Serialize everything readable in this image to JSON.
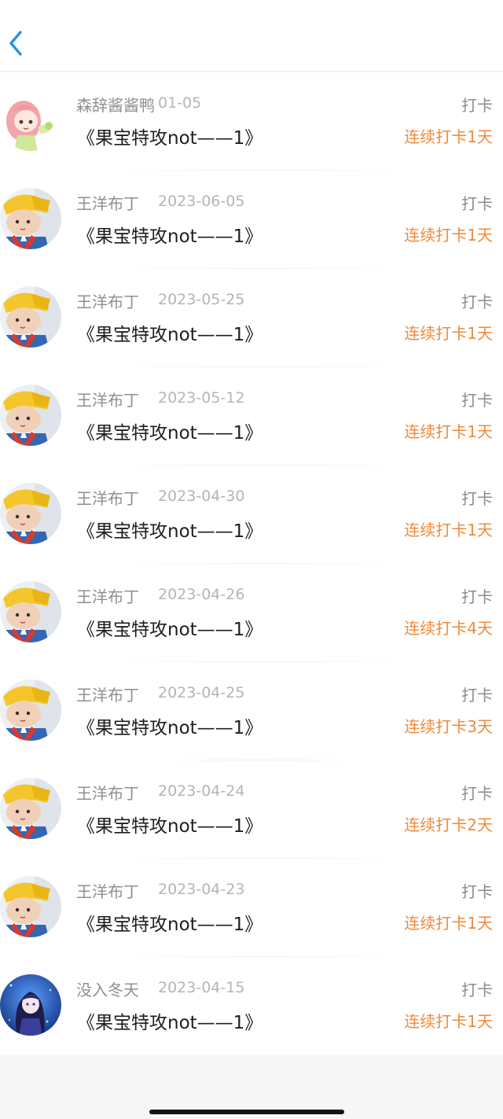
{
  "colors": {
    "back_icon": "#2b8fe6",
    "nickname": "#8f8f8f",
    "date": "#b5b5b5",
    "title": "#1e1e1e",
    "action": "#8c8c8c",
    "streak": "#ee8a3c"
  },
  "header": {
    "back_icon": "chevron-left-icon"
  },
  "records": [
    {
      "avatar": "anime-girl-pink-hair",
      "nickname": "森辞酱酱鸭",
      "date": "01-05",
      "title": "《果宝特攻not——1》",
      "action": "打卡",
      "streak": "连续打卡1天"
    },
    {
      "avatar": "yellow-cap-boy",
      "nickname": "王洋布丁",
      "date": "2023-06-05",
      "title": "《果宝特攻not——1》",
      "action": "打卡",
      "streak": "连续打卡1天"
    },
    {
      "avatar": "yellow-cap-boy",
      "nickname": "王洋布丁",
      "date": "2023-05-25",
      "title": "《果宝特攻not——1》",
      "action": "打卡",
      "streak": "连续打卡1天"
    },
    {
      "avatar": "yellow-cap-boy",
      "nickname": "王洋布丁",
      "date": "2023-05-12",
      "title": "《果宝特攻not——1》",
      "action": "打卡",
      "streak": "连续打卡1天"
    },
    {
      "avatar": "yellow-cap-boy",
      "nickname": "王洋布丁",
      "date": "2023-04-30",
      "title": "《果宝特攻not——1》",
      "action": "打卡",
      "streak": "连续打卡1天"
    },
    {
      "avatar": "yellow-cap-boy",
      "nickname": "王洋布丁",
      "date": "2023-04-26",
      "title": "《果宝特攻not——1》",
      "action": "打卡",
      "streak": "连续打卡4天"
    },
    {
      "avatar": "yellow-cap-boy",
      "nickname": "王洋布丁",
      "date": "2023-04-25",
      "title": "《果宝特攻not——1》",
      "action": "打卡",
      "streak": "连续打卡3天"
    },
    {
      "avatar": "yellow-cap-boy",
      "nickname": "王洋布丁",
      "date": "2023-04-24",
      "title": "《果宝特攻not——1》",
      "action": "打卡",
      "streak": "连续打卡2天"
    },
    {
      "avatar": "yellow-cap-boy",
      "nickname": "王洋布丁",
      "date": "2023-04-23",
      "title": "《果宝特攻not——1》",
      "action": "打卡",
      "streak": "连续打卡1天"
    },
    {
      "avatar": "blue-anime-girl",
      "nickname": "没入冬天",
      "date": "2023-04-15",
      "title": "《果宝特攻not——1》",
      "action": "打卡",
      "streak": "连续打卡1天"
    }
  ]
}
